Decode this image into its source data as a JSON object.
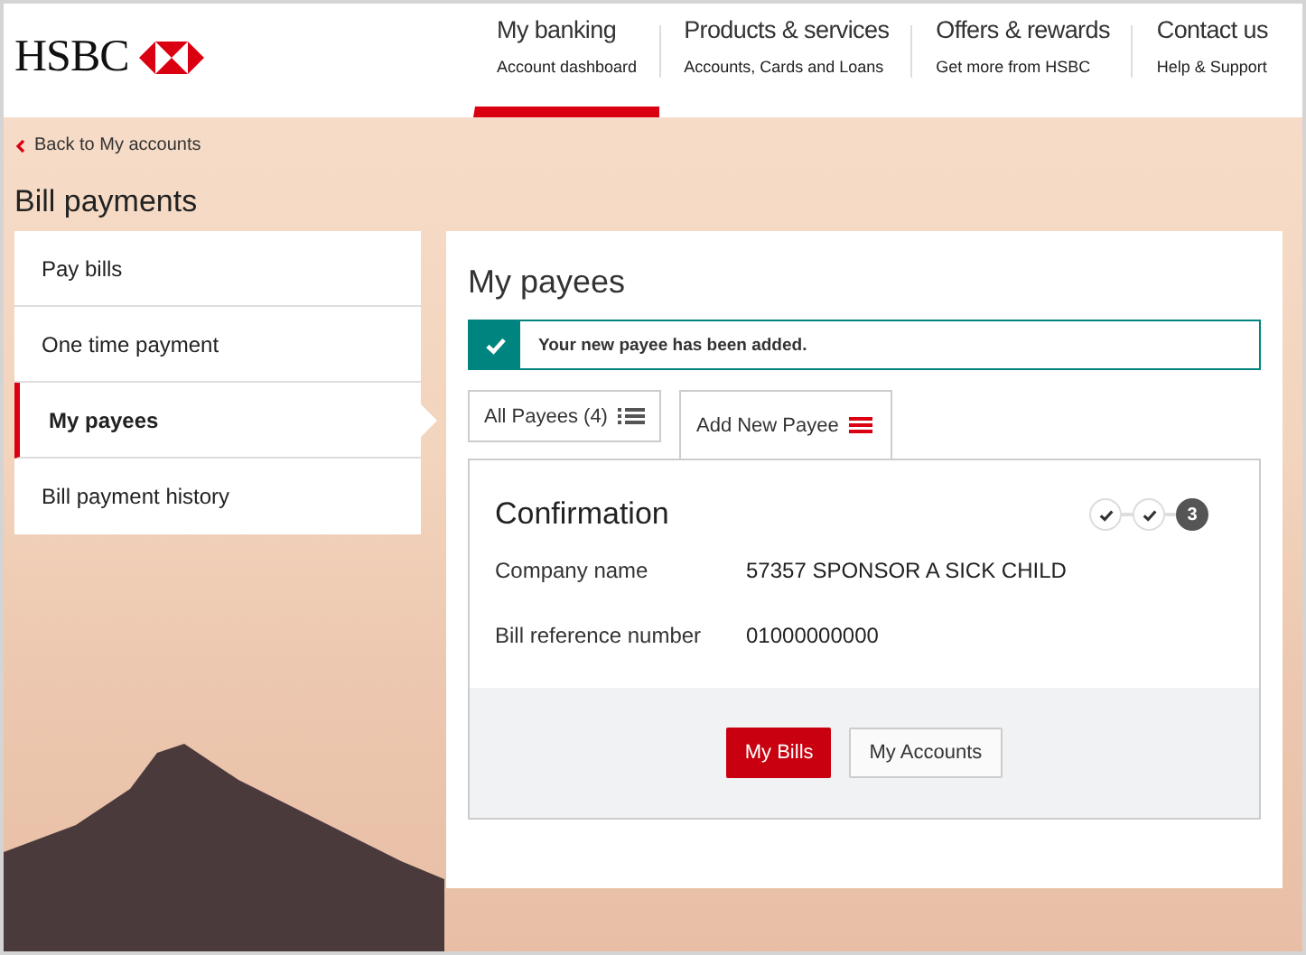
{
  "header": {
    "logo": "HSBC",
    "nav": [
      {
        "title": "My banking",
        "subtitle": "Account dashboard",
        "selected": true
      },
      {
        "title": "Products & services",
        "subtitle": "Accounts, Cards and Loans",
        "selected": false
      },
      {
        "title": "Offers & rewards",
        "subtitle": "Get more from HSBC",
        "selected": false
      },
      {
        "title": "Contact us",
        "subtitle": "Help & Support",
        "selected": false
      }
    ]
  },
  "back_link": "Back to My accounts",
  "page_title": "Bill payments",
  "sidebar": {
    "items": [
      {
        "label": "Pay bills",
        "selected": false
      },
      {
        "label": "One time payment",
        "selected": false
      },
      {
        "label": "My payees",
        "selected": true
      },
      {
        "label": "Bill payment history",
        "selected": false
      }
    ]
  },
  "panel": {
    "title": "My payees",
    "alert": "Your new payee has been added.",
    "tabs": [
      {
        "label": "All Payees (4)",
        "selected": false
      },
      {
        "label": "Add New Payee",
        "selected": true
      }
    ],
    "card": {
      "title": "Confirmation",
      "steps": [
        {
          "kind": "done"
        },
        {
          "kind": "done"
        },
        {
          "kind": "current",
          "label": "3"
        }
      ],
      "fields": [
        {
          "label": "Company name",
          "value": "57357 SPONSOR A SICK CHILD"
        },
        {
          "label": "Bill reference number",
          "value": "01000000000"
        }
      ],
      "buttons": [
        {
          "label": "My Bills",
          "kind": "primary"
        },
        {
          "label": "My Accounts",
          "kind": "secondary"
        }
      ]
    }
  }
}
